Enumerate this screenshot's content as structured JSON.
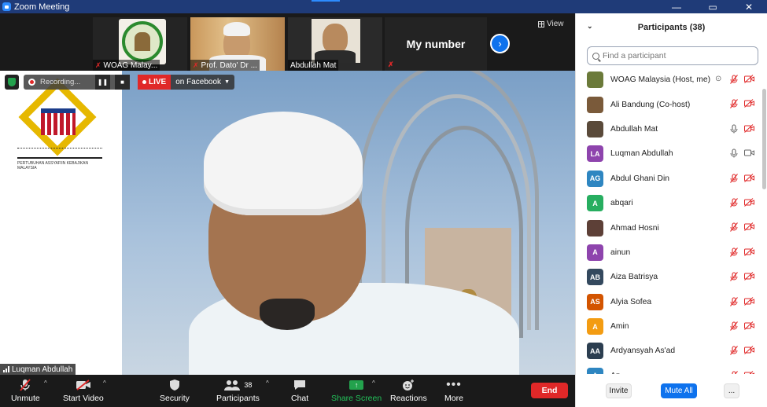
{
  "window": {
    "title": "Zoom Meeting",
    "controls": [
      "—",
      "▭",
      "✕"
    ]
  },
  "strip": {
    "thumbnails": [
      {
        "name": "WOAG Malay...",
        "muted": true
      },
      {
        "name": "Prof. Dato' Dr ...",
        "muted": true
      },
      {
        "name": "Abdullah Mat",
        "muted": false
      },
      {
        "name": "",
        "muted": true
      }
    ],
    "mynumber": "My number",
    "view_label": "View"
  },
  "speaker": {
    "recording_label": "Recording...",
    "live_label": "LIVE",
    "live_target": "on Facebook",
    "speaker_name": "Luqman Abdullah",
    "brand_sub": "PERTUBUHAN ASSYAFIIN KEBAJIKAN MALAYSIA"
  },
  "toolbar": {
    "unmute": "Unmute",
    "start_video": "Start Video",
    "security": "Security",
    "participants": "Participants",
    "participants_count": "38",
    "chat": "Chat",
    "share_screen": "Share Screen",
    "reactions": "Reactions",
    "more": "More",
    "end": "End"
  },
  "panel": {
    "title": "Participants (38)",
    "search_placeholder": "Find a participant",
    "participants": [
      {
        "name": "WOAG Malaysia (Host, me)",
        "initials": "",
        "color": "#6b7a3a",
        "mic": "off",
        "video": "off",
        "extra": "record"
      },
      {
        "name": "Ali Bandung (Co-host)",
        "initials": "",
        "color": "#7a5a3a",
        "mic": "off",
        "video": "off"
      },
      {
        "name": "Abdullah Mat",
        "initials": "",
        "color": "#5a4a3a",
        "mic": "on",
        "video": "off"
      },
      {
        "name": "Luqman Abdullah",
        "initials": "LA",
        "color": "#8e44ad",
        "mic": "on",
        "video": "on"
      },
      {
        "name": "Abdul Ghani Din",
        "initials": "AG",
        "color": "#2e86c1",
        "mic": "off",
        "video": "off"
      },
      {
        "name": "abqari",
        "initials": "A",
        "color": "#27ae60",
        "mic": "off",
        "video": "off"
      },
      {
        "name": "Ahmad Hosni",
        "initials": "",
        "color": "#5d4037",
        "mic": "off",
        "video": "off"
      },
      {
        "name": "ainun",
        "initials": "A",
        "color": "#8e44ad",
        "mic": "off",
        "video": "off"
      },
      {
        "name": "Aiza Batrisya",
        "initials": "AB",
        "color": "#34495e",
        "mic": "off",
        "video": "off"
      },
      {
        "name": "Alyia Sofea",
        "initials": "AS",
        "color": "#d35400",
        "mic": "off",
        "video": "off"
      },
      {
        "name": "Amin",
        "initials": "A",
        "color": "#f39c12",
        "mic": "off",
        "video": "off"
      },
      {
        "name": "Ardyansyah As'ad",
        "initials": "AA",
        "color": "#2c3e50",
        "mic": "off",
        "video": "off"
      },
      {
        "name": "Az...",
        "initials": "A",
        "color": "#2e86c1",
        "mic": "off",
        "video": "off"
      }
    ],
    "invite": "Invite",
    "mute_all": "Mute All",
    "more": "..."
  }
}
